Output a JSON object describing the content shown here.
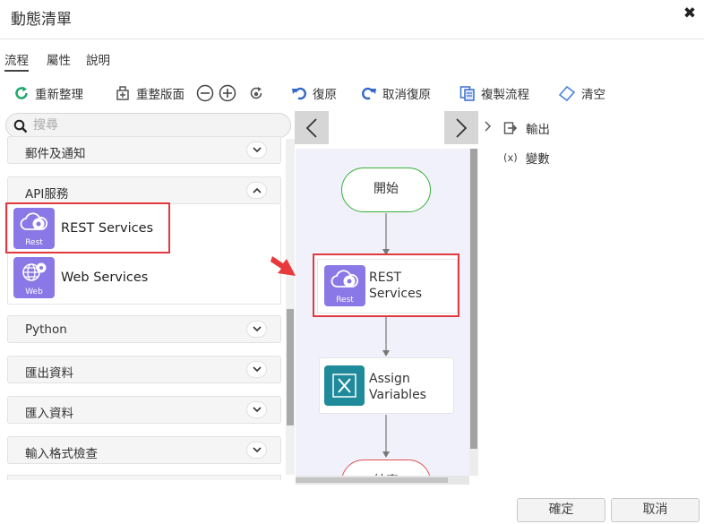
{
  "window": {
    "title": "動態清單",
    "close_icon": "close-icon"
  },
  "tabs": [
    {
      "label": "流程",
      "active": true
    },
    {
      "label": "屬性",
      "active": false
    },
    {
      "label": "說明",
      "active": false
    }
  ],
  "toolbar": {
    "rearrange": "重新整理",
    "reset_layout": "重整版面",
    "undo": "復原",
    "redo": "取消復原",
    "copy_flow": "複製流程",
    "clear": "清空"
  },
  "search": {
    "placeholder": "搜尋",
    "value": ""
  },
  "palette": {
    "categories": [
      {
        "label": "郵件及通知",
        "expanded": false
      },
      {
        "label": "API服務",
        "expanded": true
      },
      {
        "label": "Python",
        "expanded": false
      },
      {
        "label": "匯出資料",
        "expanded": false
      },
      {
        "label": "匯入資料",
        "expanded": false
      },
      {
        "label": "輸入格式檢查",
        "expanded": false
      }
    ],
    "api_items": [
      {
        "label": "REST Services",
        "icon_caption": "Rest"
      },
      {
        "label": "Web Services",
        "icon_caption": "Web"
      }
    ]
  },
  "flow": {
    "start_label": "開始",
    "rest_node": "REST\nServices",
    "rest_node_caption": "Rest",
    "assign_node": "Assign\nVariables",
    "end_label": "結束"
  },
  "right_panel": {
    "output_label": "輸出",
    "variables_prefix": "(x)",
    "variables_label": "變數"
  },
  "footer": {
    "ok": "確定",
    "cancel": "取消"
  },
  "colors": {
    "highlight": "#e0393e",
    "api_icon": "#8a78e6",
    "assign_icon": "#1f8a9a",
    "start_border": "#34b234",
    "end_border": "#e05050"
  }
}
